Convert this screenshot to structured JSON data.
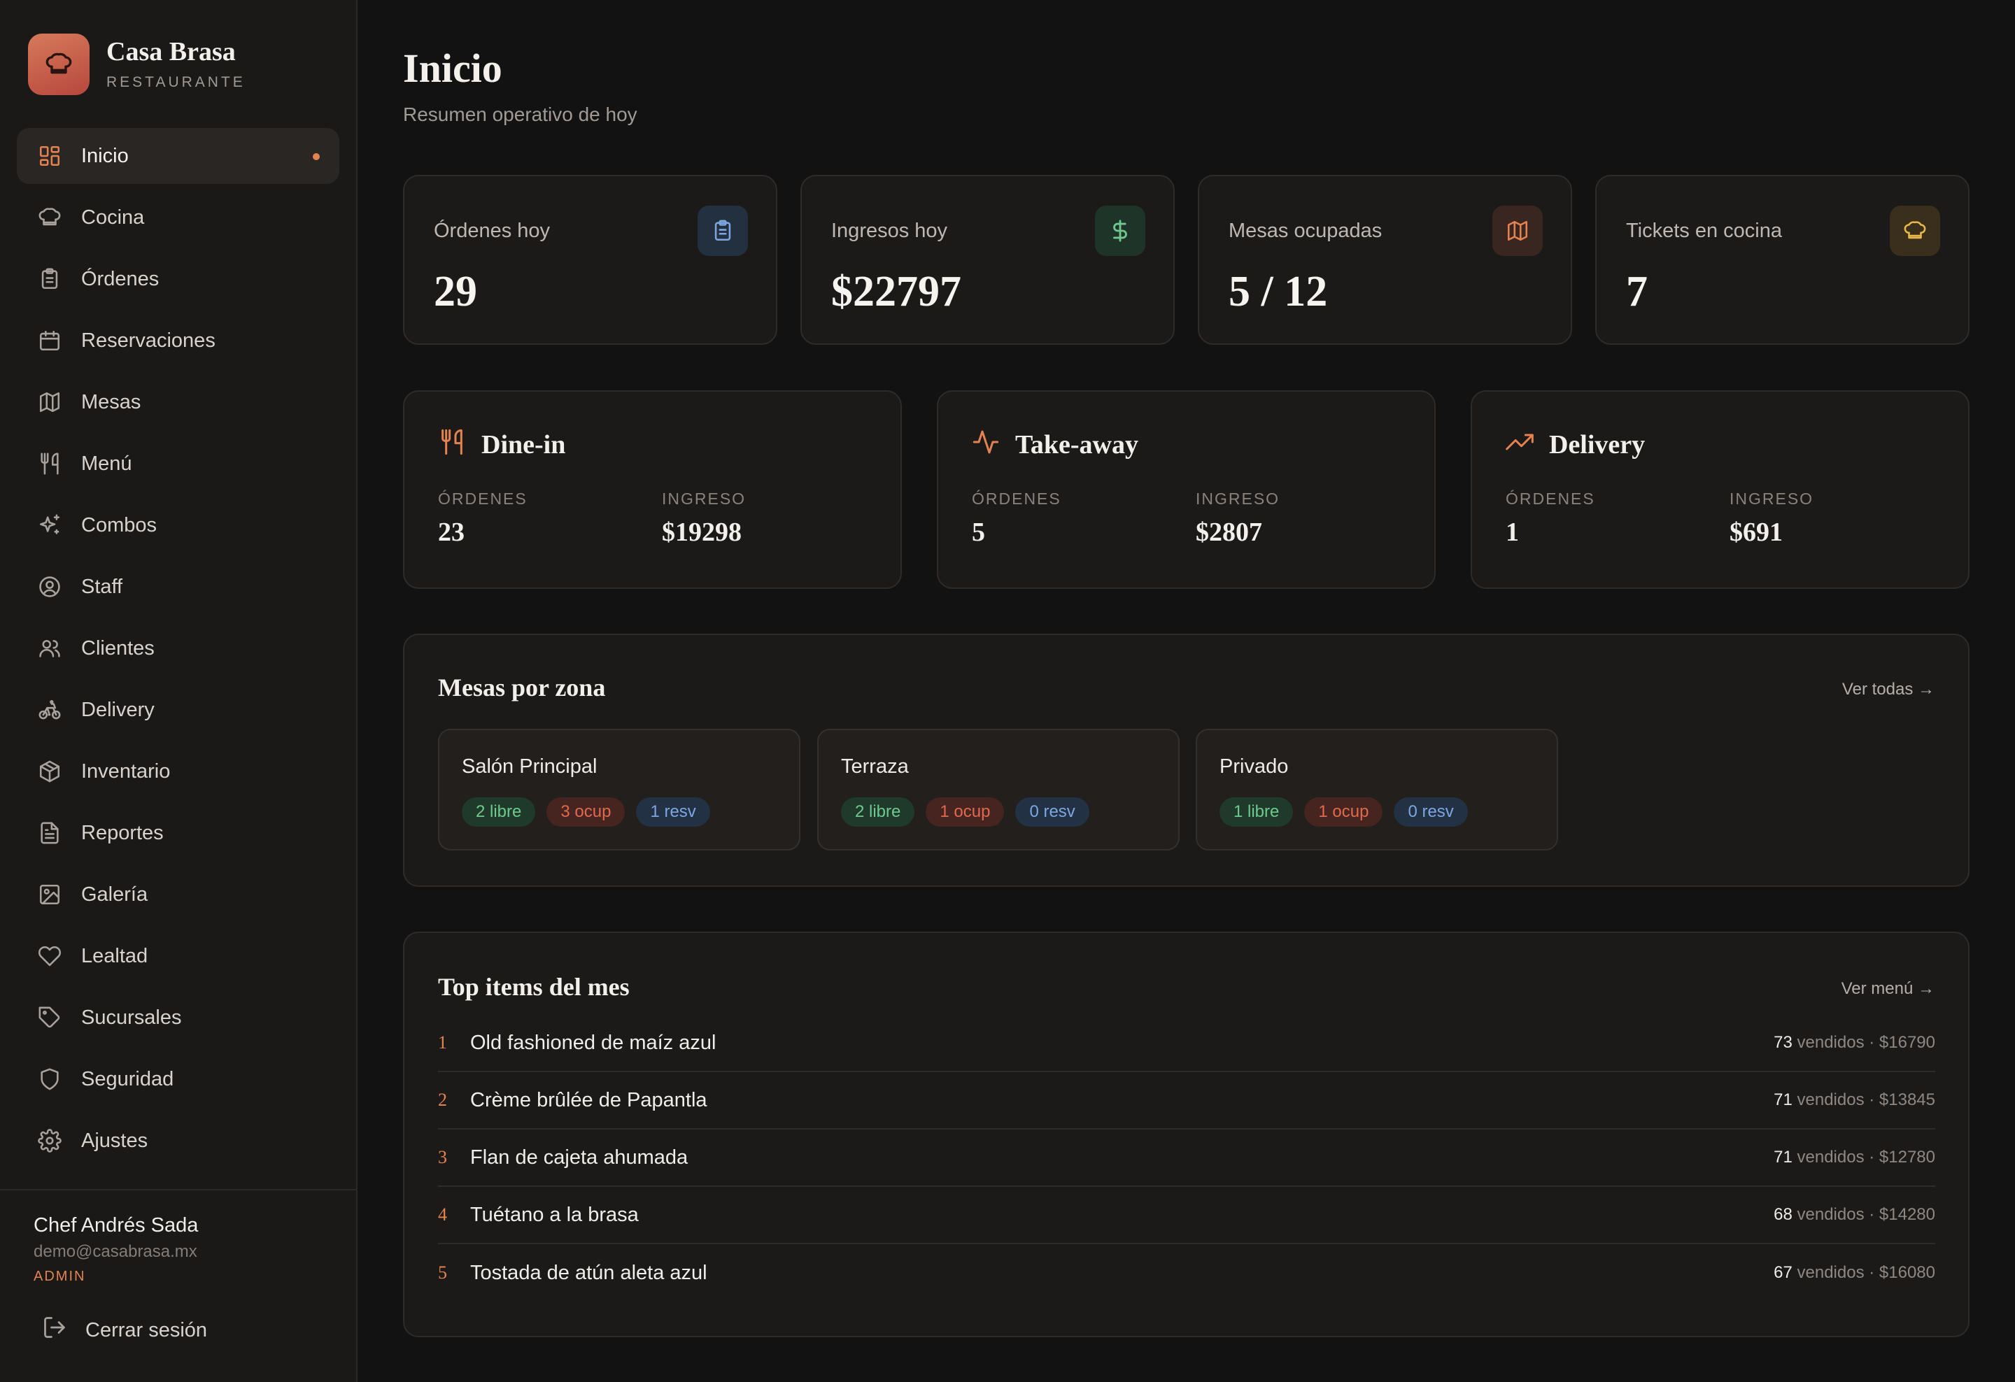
{
  "brand": {
    "name": "Casa Brasa",
    "subtitle": "RESTAURANTE"
  },
  "sidebar": {
    "items": [
      {
        "label": "Inicio",
        "icon": "dashboard-icon",
        "active": true
      },
      {
        "label": "Cocina",
        "icon": "chef-hat-icon"
      },
      {
        "label": "Órdenes",
        "icon": "clipboard-icon"
      },
      {
        "label": "Reservaciones",
        "icon": "calendar-icon"
      },
      {
        "label": "Mesas",
        "icon": "map-icon"
      },
      {
        "label": "Menú",
        "icon": "utensils-icon"
      },
      {
        "label": "Combos",
        "icon": "sparkles-icon"
      },
      {
        "label": "Staff",
        "icon": "user-circle-icon"
      },
      {
        "label": "Clientes",
        "icon": "users-icon"
      },
      {
        "label": "Delivery",
        "icon": "bike-icon"
      },
      {
        "label": "Inventario",
        "icon": "package-icon"
      },
      {
        "label": "Reportes",
        "icon": "file-text-icon"
      },
      {
        "label": "Galería",
        "icon": "image-icon"
      },
      {
        "label": "Lealtad",
        "icon": "heart-icon"
      },
      {
        "label": "Sucursales",
        "icon": "tag-icon"
      },
      {
        "label": "Seguridad",
        "icon": "shield-icon"
      },
      {
        "label": "Ajustes",
        "icon": "gear-icon"
      }
    ],
    "user": {
      "name": "Chef Andrés Sada",
      "email": "demo@casabrasa.mx",
      "role": "ADMIN"
    },
    "logout_label": "Cerrar sesión"
  },
  "header": {
    "title": "Inicio",
    "subtitle": "Resumen operativo de hoy"
  },
  "stats": [
    {
      "label": "Órdenes hoy",
      "value": "29",
      "icon": "clipboard-icon",
      "color": "#7ea6e0"
    },
    {
      "label": "Ingresos hoy",
      "value": "$22797",
      "icon": "dollar-icon",
      "color": "#6fc98f"
    },
    {
      "label": "Mesas ocupadas",
      "value": "5 / 12",
      "icon": "map-icon",
      "color": "#e48350"
    },
    {
      "label": "Tickets en cocina",
      "value": "7",
      "icon": "chef-hat-icon",
      "color": "#e8b84a"
    }
  ],
  "services": [
    {
      "title": "Dine-in",
      "icon": "utensils-icon",
      "orders_label": "ÓRDENES",
      "orders": "23",
      "revenue_label": "INGRESO",
      "revenue": "$19298"
    },
    {
      "title": "Take-away",
      "icon": "activity-icon",
      "orders_label": "ÓRDENES",
      "orders": "5",
      "revenue_label": "INGRESO",
      "revenue": "$2807"
    },
    {
      "title": "Delivery",
      "icon": "trending-up-icon",
      "orders_label": "ÓRDENES",
      "orders": "1",
      "revenue_label": "INGRESO",
      "revenue": "$691"
    }
  ],
  "zones_section": {
    "title": "Mesas por zona",
    "link": "Ver todas →",
    "zones": [
      {
        "name": "Salón Principal",
        "libre": "2 libre",
        "ocup": "3 ocup",
        "resv": "1 resv"
      },
      {
        "name": "Terraza",
        "libre": "2 libre",
        "ocup": "1 ocup",
        "resv": "0 resv"
      },
      {
        "name": "Privado",
        "libre": "1 libre",
        "ocup": "1 ocup",
        "resv": "0 resv"
      }
    ]
  },
  "top_section": {
    "title": "Top items del mes",
    "link": "Ver menú →",
    "items": [
      {
        "rank": "1",
        "name": "Old fashioned de maíz azul",
        "sold": "73",
        "sold_label": "vendidos · $16790"
      },
      {
        "rank": "2",
        "name": "Crème brûlée de Papantla",
        "sold": "71",
        "sold_label": "vendidos · $13845"
      },
      {
        "rank": "3",
        "name": "Flan de cajeta ahumada",
        "sold": "71",
        "sold_label": "vendidos · $12780"
      },
      {
        "rank": "4",
        "name": "Tuétano a la brasa",
        "sold": "68",
        "sold_label": "vendidos · $14280"
      },
      {
        "rank": "5",
        "name": "Tostada de atún aleta azul",
        "sold": "67",
        "sold_label": "vendidos · $16080"
      }
    ]
  },
  "colors": {
    "accent": "#e48350",
    "background": "#131212",
    "card": "#1c1a19"
  }
}
